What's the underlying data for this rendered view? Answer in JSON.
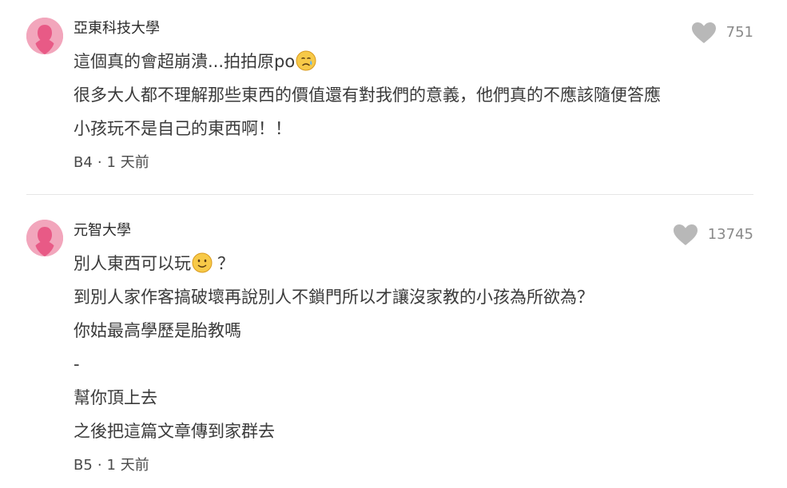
{
  "comments": [
    {
      "author": "亞東科技大學",
      "likes": "751",
      "line1_text": "這個真的會超崩潰...拍拍原po",
      "line1_emoji": "crying-face-emoji",
      "line2": "很多大人都不理解那些東西的價值還有對我們的意義，他們真的不應該隨便答應",
      "line3": "小孩玩不是自己的東西啊！！",
      "floor": "B4",
      "time": "1 天前"
    },
    {
      "author": "元智大學",
      "likes": "13745",
      "line1_text": "別人東西可以玩",
      "line1_emoji": "smiling-face-emoji",
      "line1_suffix": "？",
      "line2": "到別人家作客搞破壞再說別人不鎖門所以才讓沒家教的小孩為所欲為？",
      "line3": "你姑最高學歷是胎教嗎",
      "line4": "-",
      "line5": "幫你頂上去",
      "line6": "之後把這篇文章傳到家群去",
      "floor": "B5",
      "time": "1 天前"
    }
  ],
  "meta_separator": "·",
  "colors": {
    "avatar_bg": "#f2a6bc",
    "avatar_figure": "#e85a86",
    "like_icon": "#b8b8b8",
    "like_count": "#8a8a8a",
    "text": "#3a3a3a",
    "emoji_face": "#f7c948"
  },
  "icons": {
    "avatar": "female-avatar-icon",
    "like": "heart-icon"
  }
}
